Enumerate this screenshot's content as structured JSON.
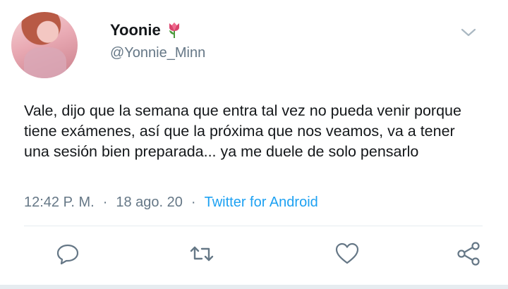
{
  "tweet": {
    "author_name": "Yoonie",
    "author_handle": "@Yonnie_Minn",
    "text": "Vale, dijo que la semana que entra tal vez no pueda venir porque tiene exámenes, así que la próxima que nos veamos, va a tener una sesión bien preparada... ya me duele de solo pensarlo",
    "time": "12:42 P. M.",
    "separator": "·",
    "date": "18 ago. 20",
    "source": "Twitter for Android"
  },
  "icons": {
    "name_emoji": "tulip-icon",
    "menu": "chevron-down-icon",
    "reply": "reply-icon",
    "retweet": "retweet-icon",
    "like": "heart-icon",
    "share": "share-icon"
  },
  "colors": {
    "accent": "#1da1f2",
    "text": "#14171a",
    "muted": "#657786"
  }
}
